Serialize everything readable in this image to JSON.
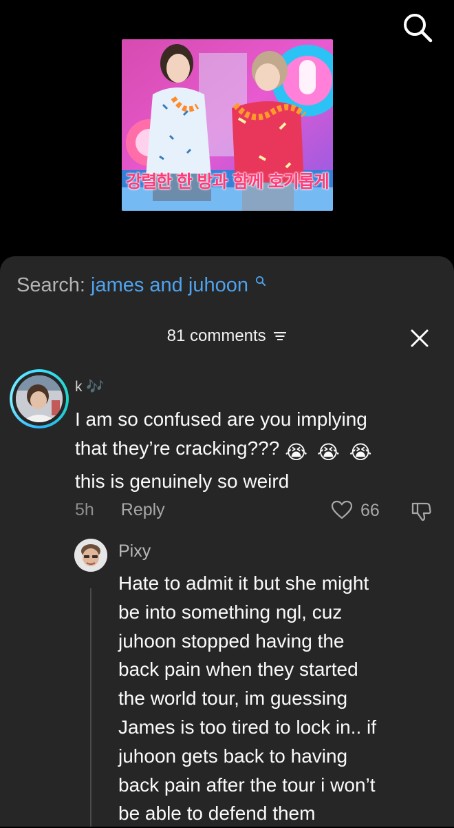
{
  "header": {
    "search_icon": "search-icon"
  },
  "video": {
    "caption": "강렬한 한 방과 함께 호기롭게"
  },
  "search_suggestion": {
    "prefix": "Search:",
    "query": "james and juhoon"
  },
  "comments": {
    "count_label": "81 comments",
    "filter_icon": "filter-icon",
    "close_icon": "close-icon"
  },
  "comment": {
    "username": "k 🎶",
    "lines": [
      "I am so confused are you implying",
      "that they’re cracking???",
      "this is genuinely so weird"
    ],
    "emoji": "😭😭😭",
    "time": "5h",
    "reply_label": "Reply",
    "likes": "66"
  },
  "reply": {
    "username": "Pixy",
    "lines": [
      "Hate to admit it but she might",
      "be into something ngl, cuz",
      "juhoon stopped having the",
      "back pain when they started",
      "the world tour, im guessing",
      "James is too tired to lock in.. if",
      "juhoon gets back to having",
      "back pain after the tour i won’t",
      "be able to defend them"
    ]
  },
  "colors": {
    "sheet_bg": "#262626",
    "link_blue": "#4fa3ee",
    "ring": "#3fe0ff"
  }
}
